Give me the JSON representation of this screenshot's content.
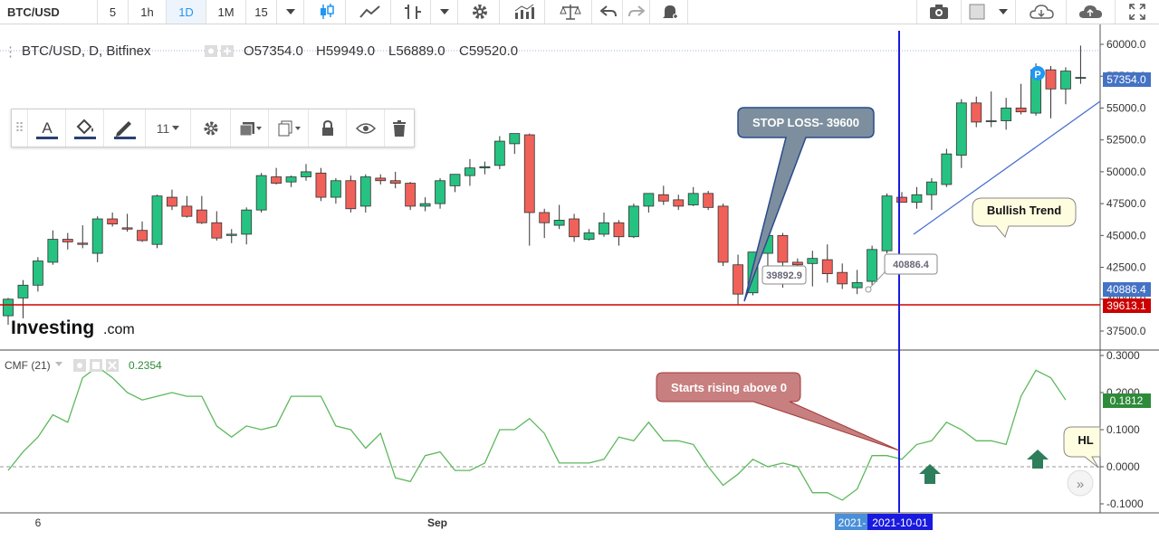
{
  "toolbar": {
    "symbol": "BTC/USD",
    "intervals": [
      "5",
      "1h",
      "1D",
      "1M",
      "15"
    ],
    "active_interval": "1D",
    "icons": [
      "dropdown-icon",
      "candlestick-icon",
      "area-chart-icon",
      "bar-chart-icon",
      "dropdown-icon",
      "settings-gear-icon",
      "indicators-icon",
      "compare-scale-icon",
      "undo-icon",
      "redo-icon",
      "alert-bell-icon",
      "camera-icon",
      "color-square-icon",
      "dropdown-icon",
      "cloud-download-icon",
      "cloud-upload-icon",
      "fullscreen-icon"
    ]
  },
  "legend": {
    "title": "BTC/USD, D, Bitfinex",
    "open": "O57354.0",
    "high": "H59949.0",
    "low": "L56889.0",
    "close": "C59520.0"
  },
  "drawing_toolbar": {
    "font_size": "11",
    "icons": [
      "drag-handle-icon",
      "text-color-icon",
      "fill-color-icon",
      "line-color-icon",
      "settings-gear-icon",
      "layer-icon",
      "clone-icon",
      "lock-icon",
      "visibility-eye-icon",
      "delete-trash-icon"
    ]
  },
  "watermark": {
    "brand": "Investing",
    "suffix": ".com"
  },
  "annotations": {
    "stop_loss": "STOP LOSS- 39600",
    "bullish_trend": "Bullish Trend",
    "starts_rising": "Starts rising above 0",
    "hl": "HL",
    "p_marker": "P",
    "label_low": "39892.9",
    "label_point": "40886.4"
  },
  "price_axis": {
    "ticks": [
      "60000.0",
      "57500.0",
      "55000.0",
      "52500.0",
      "50000.0",
      "47500.0",
      "45000.0",
      "42500.0",
      "40000.0",
      "37500.0"
    ],
    "last_price": "57354.0",
    "line_price": "40886.4",
    "stop_price": "39613.1"
  },
  "indicator": {
    "name": "CMF (21)",
    "value": "0.2354",
    "ticks": [
      "0.3000",
      "0.2000",
      "0.1000",
      "0.0000",
      "-0.1000"
    ],
    "last_value": "0.1812"
  },
  "time_axis": {
    "labels": [
      "6",
      "Sep"
    ],
    "cursor_date_partial": "2021-",
    "cursor_date": "2021-10-01"
  },
  "colors": {
    "up": "#26c281",
    "down": "#f0615a",
    "cursor_line": "#1a1adf",
    "stop_line": "#d40000",
    "cmf_line": "#5cb85c",
    "stop_loss_fill": "#7d8f9e",
    "starts_rising_fill": "#c87f7f",
    "callout_fill": "#fffde0"
  },
  "chart_data": [
    {
      "type": "candlestick",
      "title": "BTC/USD, D, Bitfinex",
      "ylim": [
        36400,
        61000
      ],
      "candles": [
        {
          "o": 38700,
          "h": 40100,
          "l": 38000,
          "c": 40000
        },
        {
          "o": 40100,
          "h": 41500,
          "l": 38500,
          "c": 41100
        },
        {
          "o": 41100,
          "h": 43300,
          "l": 40600,
          "c": 43000
        },
        {
          "o": 42900,
          "h": 45400,
          "l": 42700,
          "c": 44700
        },
        {
          "o": 44700,
          "h": 45200,
          "l": 43900,
          "c": 44500
        },
        {
          "o": 44400,
          "h": 45800,
          "l": 44000,
          "c": 44300
        },
        {
          "o": 43600,
          "h": 46500,
          "l": 42900,
          "c": 46300
        },
        {
          "o": 46300,
          "h": 46800,
          "l": 45700,
          "c": 45900
        },
        {
          "o": 45600,
          "h": 46700,
          "l": 45300,
          "c": 45500
        },
        {
          "o": 45400,
          "h": 46100,
          "l": 44500,
          "c": 44600
        },
        {
          "o": 44300,
          "h": 48200,
          "l": 44000,
          "c": 48100
        },
        {
          "o": 48000,
          "h": 48600,
          "l": 47000,
          "c": 47300
        },
        {
          "o": 47300,
          "h": 48100,
          "l": 46400,
          "c": 46500
        },
        {
          "o": 47000,
          "h": 48100,
          "l": 45900,
          "c": 46000
        },
        {
          "o": 46000,
          "h": 46900,
          "l": 44600,
          "c": 44800
        },
        {
          "o": 45000,
          "h": 45500,
          "l": 44400,
          "c": 45100
        },
        {
          "o": 45100,
          "h": 47200,
          "l": 44300,
          "c": 47000
        },
        {
          "o": 47000,
          "h": 49900,
          "l": 46800,
          "c": 49700
        },
        {
          "o": 49600,
          "h": 50300,
          "l": 49000,
          "c": 49100
        },
        {
          "o": 49200,
          "h": 49700,
          "l": 48800,
          "c": 49600
        },
        {
          "o": 49600,
          "h": 50600,
          "l": 49300,
          "c": 50000
        },
        {
          "o": 49900,
          "h": 50300,
          "l": 47700,
          "c": 48000
        },
        {
          "o": 48000,
          "h": 49500,
          "l": 47500,
          "c": 49300
        },
        {
          "o": 49300,
          "h": 49700,
          "l": 46800,
          "c": 47100
        },
        {
          "o": 47300,
          "h": 49800,
          "l": 46800,
          "c": 49600
        },
        {
          "o": 49500,
          "h": 49800,
          "l": 49000,
          "c": 49300
        },
        {
          "o": 49300,
          "h": 50000,
          "l": 48700,
          "c": 49100
        },
        {
          "o": 49100,
          "h": 49200,
          "l": 47000,
          "c": 47300
        },
        {
          "o": 47300,
          "h": 48000,
          "l": 46900,
          "c": 47500
        },
        {
          "o": 47500,
          "h": 49500,
          "l": 47100,
          "c": 49300
        },
        {
          "o": 48900,
          "h": 49800,
          "l": 48400,
          "c": 49800
        },
        {
          "o": 49700,
          "h": 51000,
          "l": 48900,
          "c": 50300
        },
        {
          "o": 50300,
          "h": 50800,
          "l": 49800,
          "c": 50400
        },
        {
          "o": 50500,
          "h": 52800,
          "l": 50200,
          "c": 52400
        },
        {
          "o": 52200,
          "h": 53000,
          "l": 51400,
          "c": 53000
        },
        {
          "o": 52900,
          "h": 53000,
          "l": 44200,
          "c": 46800
        },
        {
          "o": 46800,
          "h": 47100,
          "l": 44800,
          "c": 46000
        },
        {
          "o": 45800,
          "h": 47400,
          "l": 45500,
          "c": 46200
        },
        {
          "o": 46300,
          "h": 46700,
          "l": 44500,
          "c": 44900
        },
        {
          "o": 44700,
          "h": 45500,
          "l": 44600,
          "c": 45200
        },
        {
          "o": 45100,
          "h": 46800,
          "l": 44900,
          "c": 46000
        },
        {
          "o": 46000,
          "h": 46200,
          "l": 44200,
          "c": 44900
        },
        {
          "o": 44900,
          "h": 47500,
          "l": 44800,
          "c": 47300
        },
        {
          "o": 47300,
          "h": 48100,
          "l": 46800,
          "c": 48300
        },
        {
          "o": 48200,
          "h": 48900,
          "l": 47400,
          "c": 47700
        },
        {
          "o": 47800,
          "h": 48200,
          "l": 47000,
          "c": 47300
        },
        {
          "o": 47400,
          "h": 48800,
          "l": 47300,
          "c": 48300
        },
        {
          "o": 48300,
          "h": 48500,
          "l": 47000,
          "c": 47200
        },
        {
          "o": 47300,
          "h": 47500,
          "l": 42600,
          "c": 42900
        },
        {
          "o": 42700,
          "h": 43500,
          "l": 39600,
          "c": 40400
        },
        {
          "o": 40500,
          "h": 43700,
          "l": 40300,
          "c": 43700
        },
        {
          "o": 43600,
          "h": 45100,
          "l": 42200,
          "c": 45000
        },
        {
          "o": 45000,
          "h": 45200,
          "l": 40900,
          "c": 42900
        },
        {
          "o": 42900,
          "h": 43200,
          "l": 42500,
          "c": 42700
        },
        {
          "o": 42800,
          "h": 43800,
          "l": 41000,
          "c": 43200
        },
        {
          "o": 43100,
          "h": 44300,
          "l": 41300,
          "c": 42000
        },
        {
          "o": 42100,
          "h": 42800,
          "l": 40800,
          "c": 41200
        },
        {
          "o": 40900,
          "h": 42300,
          "l": 40400,
          "c": 41300
        },
        {
          "o": 41400,
          "h": 44200,
          "l": 41100,
          "c": 43900
        },
        {
          "o": 43800,
          "h": 48300,
          "l": 43600,
          "c": 48100
        },
        {
          "o": 48000,
          "h": 48400,
          "l": 47700,
          "c": 47600
        },
        {
          "o": 47600,
          "h": 48800,
          "l": 47100,
          "c": 48200
        },
        {
          "o": 48200,
          "h": 49500,
          "l": 47000,
          "c": 49200
        },
        {
          "o": 49000,
          "h": 51800,
          "l": 48800,
          "c": 51400
        },
        {
          "o": 51300,
          "h": 55700,
          "l": 50300,
          "c": 55400
        },
        {
          "o": 55400,
          "h": 55900,
          "l": 53500,
          "c": 53900
        },
        {
          "o": 54000,
          "h": 56300,
          "l": 53500,
          "c": 54000
        },
        {
          "o": 54000,
          "h": 55800,
          "l": 53300,
          "c": 55000
        },
        {
          "o": 55000,
          "h": 56900,
          "l": 54500,
          "c": 54700
        },
        {
          "o": 54600,
          "h": 58500,
          "l": 54400,
          "c": 58000
        },
        {
          "o": 58000,
          "h": 58300,
          "l": 54200,
          "c": 56500
        },
        {
          "o": 56500,
          "h": 58200,
          "l": 55300,
          "c": 57900
        },
        {
          "o": 57400,
          "h": 59900,
          "l": 56900,
          "c": 57400
        }
      ],
      "support_line": 39613.1,
      "price_line": 40886.4
    },
    {
      "type": "line",
      "title": "CMF (21)",
      "ylim": [
        -0.115,
        0.31
      ],
      "series": [
        {
          "name": "CMF (21)",
          "values": [
            -0.01,
            0.04,
            0.08,
            0.14,
            0.12,
            0.24,
            0.27,
            0.24,
            0.2,
            0.18,
            0.19,
            0.2,
            0.19,
            0.19,
            0.11,
            0.08,
            0.11,
            0.1,
            0.11,
            0.19,
            0.19,
            0.19,
            0.11,
            0.1,
            0.05,
            0.09,
            -0.03,
            -0.04,
            0.03,
            0.04,
            -0.01,
            -0.01,
            0.01,
            0.1,
            0.1,
            0.13,
            0.09,
            0.01,
            0.01,
            0.01,
            0.02,
            0.08,
            0.07,
            0.12,
            0.07,
            0.07,
            0.06,
            0.0,
            -0.05,
            -0.02,
            0.02,
            0.0,
            0.01,
            0.0,
            -0.07,
            -0.07,
            -0.09,
            -0.06,
            0.03,
            0.03,
            0.02,
            0.06,
            0.07,
            0.12,
            0.1,
            0.07,
            0.07,
            0.06,
            0.19,
            0.26,
            0.24,
            0.18
          ]
        }
      ]
    }
  ]
}
